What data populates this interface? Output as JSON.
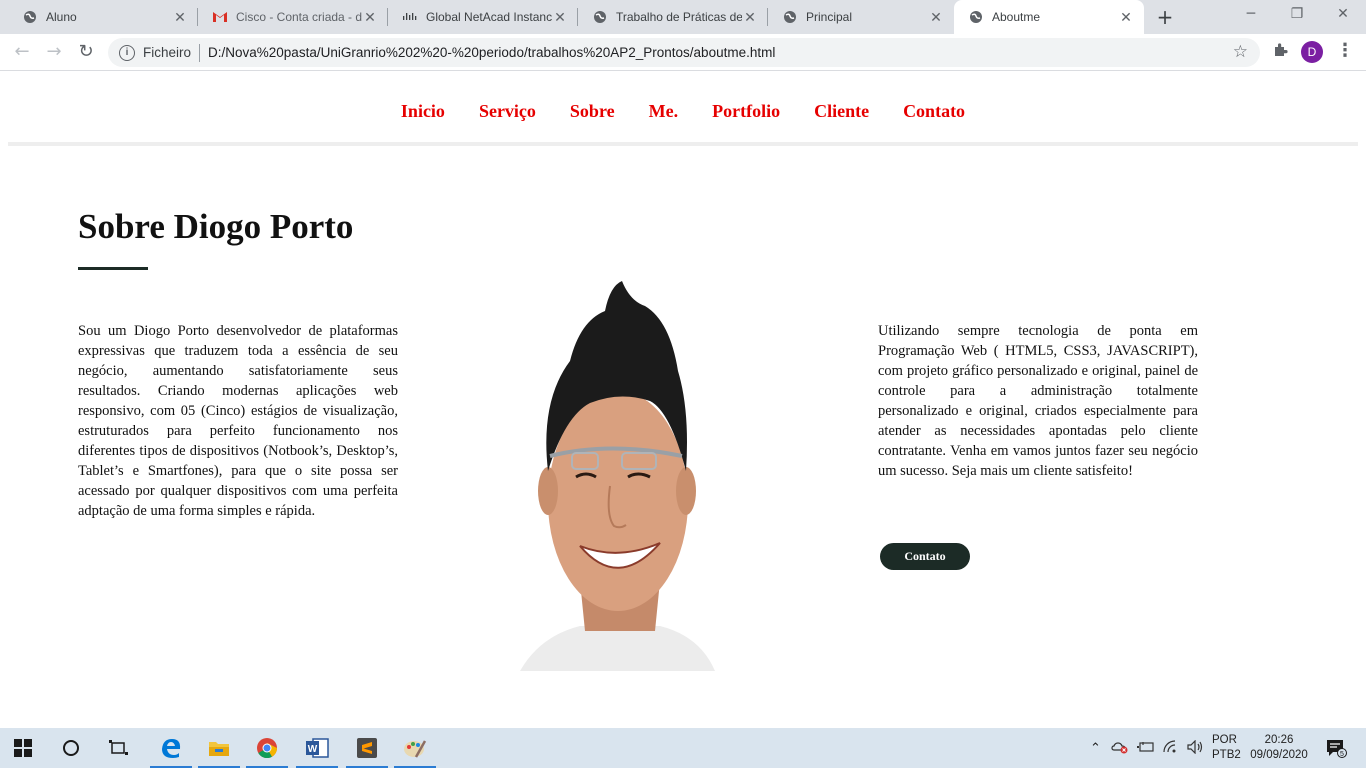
{
  "browser": {
    "tabs": [
      {
        "title": "Aluno",
        "icon": "globe-icon"
      },
      {
        "title": "Cisco - Conta criada - d",
        "icon": "gmail-icon"
      },
      {
        "title": "Global NetAcad Instanc",
        "icon": "cisco-icon"
      },
      {
        "title": "Trabalho de Práticas de",
        "icon": "globe-icon"
      },
      {
        "title": "Principal",
        "icon": "globe-icon"
      },
      {
        "title": "Aboutme",
        "icon": "globe-icon",
        "active": true
      }
    ],
    "address": {
      "scheme_label": "Ficheiro",
      "url": "D:/Nova%20pasta/UniGranrio%202%20-%20periodo/trabalhos%20AP2_Prontos/aboutme.html"
    },
    "profile_initial": "D",
    "profile_color": "#7b1fa2"
  },
  "site": {
    "nav": [
      "Inicio",
      "Serviço",
      "Sobre",
      "Me.",
      "Portfolio",
      "Cliente",
      "Contato"
    ],
    "nav_color": "#e60000",
    "heading": "Sobre Diogo Porto",
    "accent_color": "#1c2b26",
    "left_text": "Sou um Diogo Porto desenvolvedor de plataformas expressivas que traduzem toda a essência de seu negócio, aumentando satisfatoriamente seus resultados. Criando modernas aplicações web responsivo, com 05 (Cinco) estágios de visualização, estruturados para perfeito funcionamento nos diferentes tipos de dispositivos (Notbook’s, Desktop’s, Tablet’s e Smartfones), para que o site possa ser acessado por qualquer dispositivos com uma perfeita adptação de uma forma simples e rápida.",
    "right_text": "Utilizando sempre tecnologia de ponta em Programação Web ( HTML5, CSS3, JAVASCRIPT), com projeto gráfico personalizado e original, painel de controle para a administração totalmente personalizado e original, criados especialmente para atender as necessidades apontadas pelo cliente contratante. Venha em vamos juntos fazer seu negócio um sucesso. Seja mais um cliente satisfeito!",
    "contact_button": "Contato"
  },
  "taskbar": {
    "apps": [
      "windows-start-icon",
      "cortana-icon",
      "task-view-icon",
      "edge-icon",
      "file-explorer-icon",
      "chrome-icon",
      "word-icon",
      "sublime-icon",
      "paint-icon"
    ],
    "language": [
      "POR",
      "PTB2"
    ],
    "time": "20:26",
    "date": "09/09/2020",
    "notifications": "5"
  }
}
